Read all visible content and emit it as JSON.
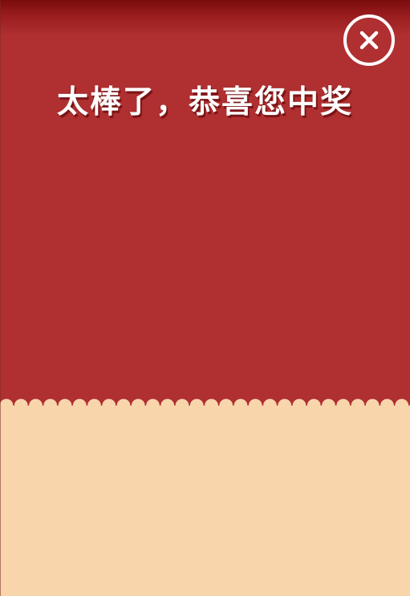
{
  "dialog": {
    "headline": "太棒了，恭喜您中奖",
    "close_icon": "close-icon"
  },
  "colors": {
    "top_panel": "#b02f30",
    "top_shade": "#7a0c0d",
    "bottom_panel": "#f8d5ab",
    "text": "#ffffff",
    "text_shadow": "#7a1416"
  }
}
